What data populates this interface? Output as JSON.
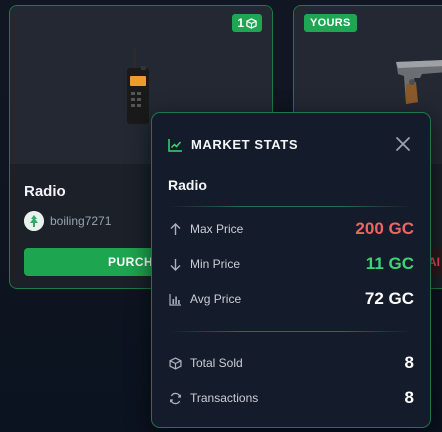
{
  "cards": {
    "radio": {
      "quantity_badge": "1",
      "name": "Radio",
      "owner": "boiling7271",
      "purchase_label": "PURCHASE"
    },
    "other": {
      "badge": "YOURS"
    }
  },
  "popup": {
    "title": "MARKET STATS",
    "item_name": "Radio",
    "stats": [
      {
        "label": "Max Price",
        "value": "200 GC",
        "icon": "arrow-up-icon"
      },
      {
        "label": "Min Price",
        "value": "11 GC",
        "icon": "arrow-down-icon"
      },
      {
        "label": "Avg Price",
        "value": "72 GC",
        "icon": "bar-chart-icon"
      }
    ],
    "totals": [
      {
        "label": "Total Sold",
        "value": "8",
        "icon": "cube-icon"
      },
      {
        "label": "Transactions",
        "value": "8",
        "icon": "refresh-icon"
      }
    ]
  },
  "colors": {
    "accent_green": "#1fa653",
    "max_price_red": "#f06464",
    "min_price_green": "#3bd66f",
    "popup_bg": "#141b2a"
  }
}
